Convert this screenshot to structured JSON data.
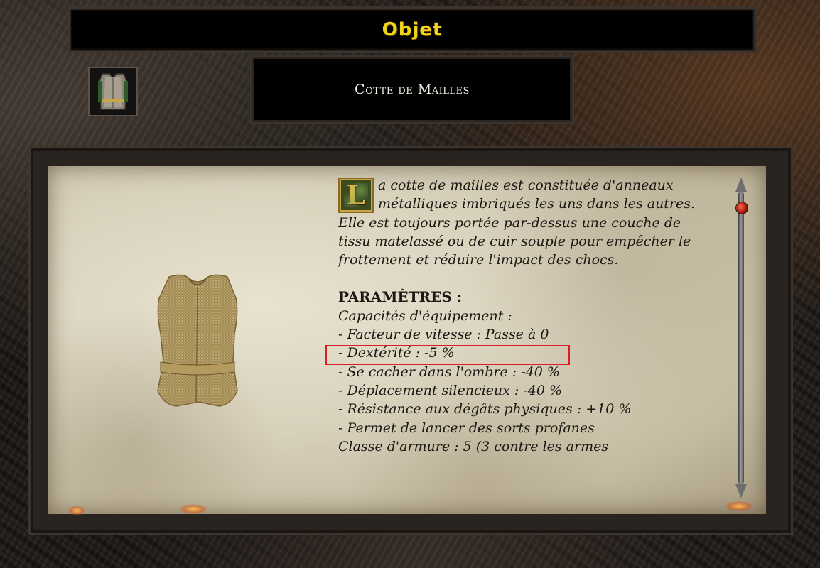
{
  "header": {
    "title": "Objet"
  },
  "item": {
    "name": "Cotte de Mailles",
    "icon": "chainmail-icon",
    "picture": "chainmail-picture"
  },
  "description": {
    "drop_cap": "L",
    "lines": [
      "a cotte de mailles est constituée d'anneaux",
      "métalliques imbriqués les uns dans les autres.",
      "Elle est toujours portée par-dessus une couche de",
      "tissu matelassé ou de cuir souple pour empêcher le",
      "frottement et réduire l'impact des chocs."
    ]
  },
  "parameters": {
    "heading": "PARAMÈTRES :",
    "capabilities_title": "Capacités d'équipement :",
    "capabilities": [
      "- Facteur de vitesse : Passe à 0",
      "- Dextérité : -5 %",
      "- Se cacher dans l'ombre : -40 %",
      "- Déplacement silencieux : -40 %",
      "- Résistance aux dégâts physiques : +10 %",
      "- Permet de lancer des sorts profanes"
    ],
    "armor_class": "Classe d'armure : 5 (3 contre les armes"
  },
  "colors": {
    "title": "#f1d21b",
    "highlight": "#d81f26",
    "parchment": "#d9d2bd"
  }
}
